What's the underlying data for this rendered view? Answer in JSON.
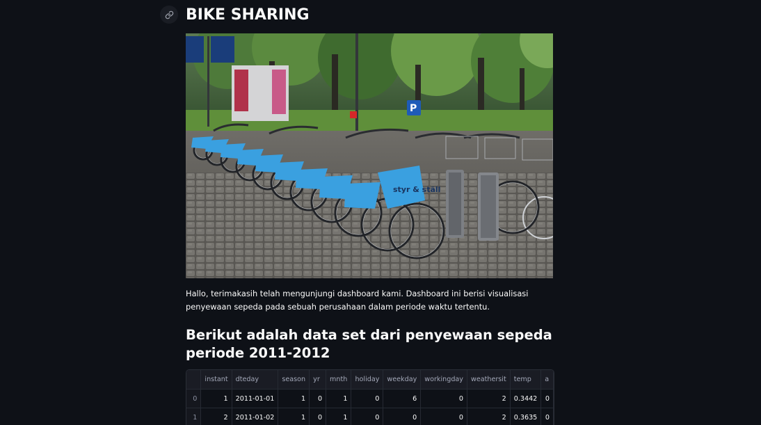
{
  "page": {
    "title": "BIKE SHARING",
    "intro": "Hallo, terimakasih telah mengunjungi dashboard kami. Dashboard ini berisi visualisasi penyewaan sepeda pada sebuah perusahaan dalam periode waktu tertentu.",
    "subheader": "Berikut adalah data set dari penyewaan sepeda periode 2011-2012"
  },
  "image": {
    "alt": "Row of blue shared bicycles docked at a bike sharing station",
    "sign_text": "styr & ställ"
  },
  "icons": {
    "anchor": "link-icon"
  },
  "colors": {
    "background": "#0e1117",
    "text": "#fafafa",
    "bike_blue": "#3aa0e0"
  },
  "table": {
    "columns": [
      "",
      "instant",
      "dteday",
      "season",
      "yr",
      "mnth",
      "holiday",
      "weekday",
      "workingday",
      "weathersit",
      "temp",
      "a"
    ],
    "rows": [
      [
        "0",
        "1",
        "2011-01-01",
        "1",
        "0",
        "1",
        "0",
        "6",
        "0",
        "2",
        "0.3442",
        "0"
      ],
      [
        "1",
        "2",
        "2011-01-02",
        "1",
        "0",
        "1",
        "0",
        "0",
        "0",
        "2",
        "0.3635",
        "0"
      ]
    ]
  }
}
